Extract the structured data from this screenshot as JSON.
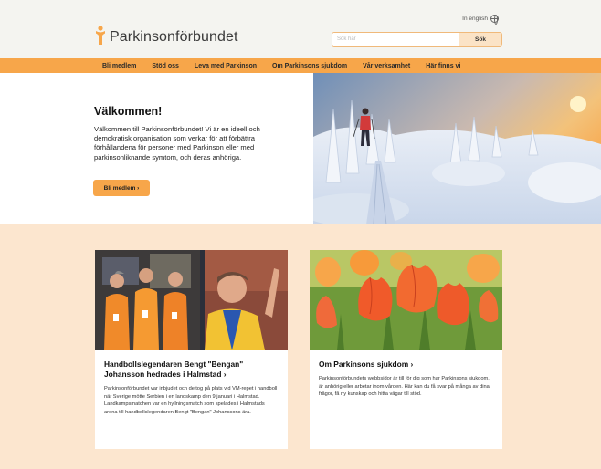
{
  "header": {
    "language": "In english",
    "logo_text": "Parkinsonförbundet",
    "search_placeholder": "Sök här",
    "search_button": "Sök"
  },
  "nav": {
    "items": [
      "Bli medlem",
      "Stöd oss",
      "Leva med Parkinson",
      "Om Parkinsons sjukdom",
      "Vår verksamhet",
      "Här finns vi"
    ]
  },
  "hero": {
    "title": "Välkommen!",
    "text": "Välkommen till Parkinsonförbundet! Vi är en ideell och demokratisk organisation som verkar för att förbättra förhållandena för personer med Parkinson eller med parkinsonliknande symtom, och deras anhöriga.",
    "button": "Bli medlem ›"
  },
  "cards": [
    {
      "title": "Handbollslegendaren Bengt \"Bengan\" Johansson hedrades i Halmstad ›",
      "text": "Parkinsonförbundet var inbjudet och deltog på plats vid VM-repet i handboll när Sverige mötte Serbien i en landskamp den 9 januari i Halmstad. Landkampsmatchen var en hyllningsmatch som spelades i Halmstads arena till handbollslegendaren Bengt \"Bengan\" Johanssons ära."
    },
    {
      "title": "Om Parkinsons sjukdom ›",
      "text": "Parkinsonförbundets webbsidor är till för dig som har Parkinsons sjukdom, är anhörig eller arbetar inom vården. Här kan du få svar på många av dina frågor, få ny kunskap och hitta vägar till stöd."
    }
  ],
  "colors": {
    "accent": "#f7a64a",
    "section_bg": "#fce6cf",
    "header_bg": "#f4f4f0"
  }
}
